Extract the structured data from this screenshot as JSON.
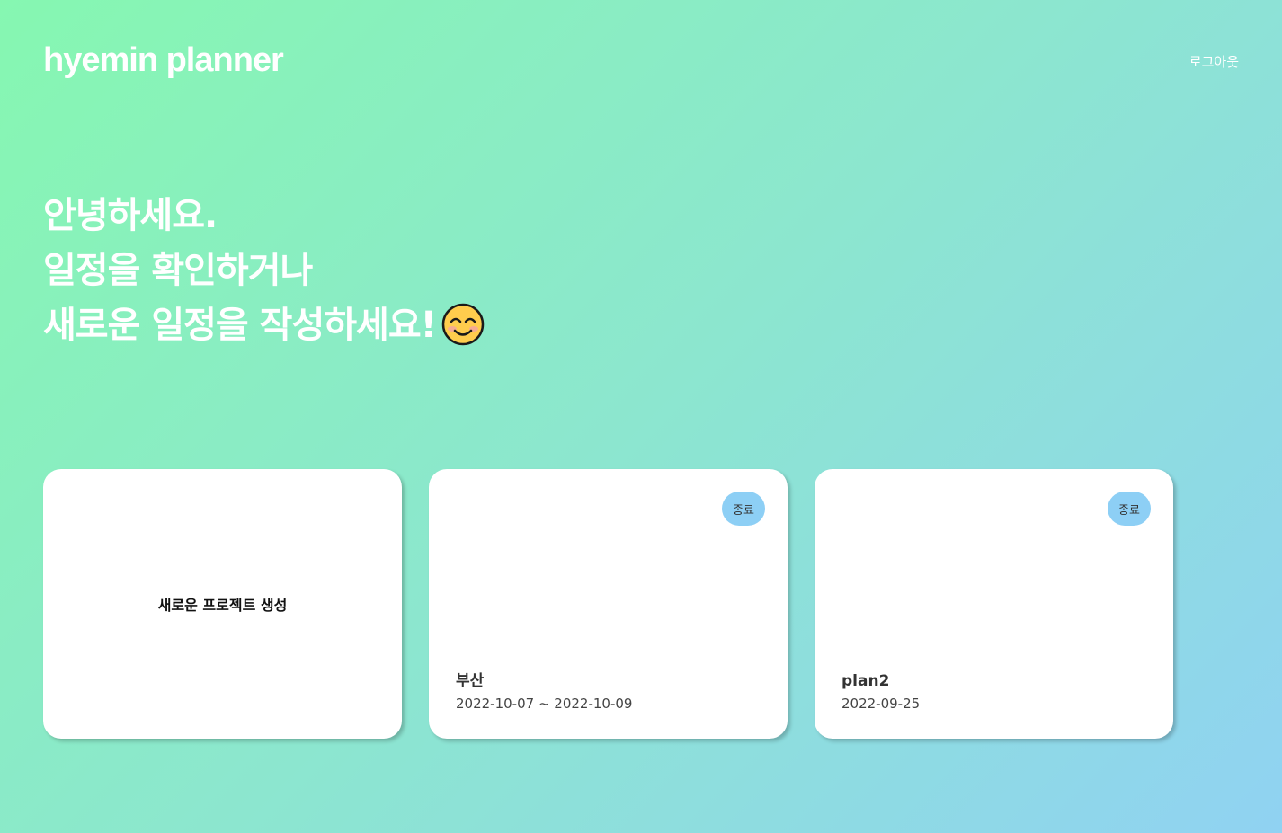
{
  "header": {
    "logo": "hyemin planner",
    "logout_label": "로그아웃"
  },
  "hero": {
    "line1": "안녕하세요.",
    "line2": "일정을 확인하거나",
    "line3": "새로운 일정을 작성하세요!",
    "emoji_icon": "smiling-face-icon"
  },
  "cards": {
    "new_project_label": "새로운 프로젝트 생성",
    "projects": [
      {
        "status": "종료",
        "title": "부산",
        "date": "2022-10-07 ~ 2022-10-09"
      },
      {
        "status": "종료",
        "title": "plan2",
        "date": "2022-09-25"
      }
    ]
  },
  "colors": {
    "gradient_start": "#86f7b1",
    "gradient_end": "#90d2f2",
    "badge_bg": "#8dcff5"
  }
}
